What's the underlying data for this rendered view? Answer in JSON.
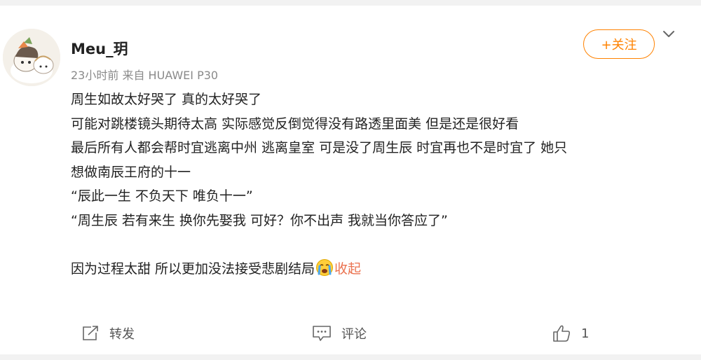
{
  "post": {
    "username": "Meu_玥",
    "meta": "23小时前  来自 HUAWEI P30",
    "follow_label": "+关注",
    "lines": [
      "周生如故太好哭了 真的太好哭了",
      "可能对跳楼镜头期待太高 实际感觉反倒觉得没有路透里面美 但是还是很好看",
      "最后所有人都会帮时宜逃离中州 逃离皇室 可是没了周生辰 时宜再也不是时宜了 她只",
      "想做南辰王府的十一",
      "“辰此一生 不负天下 唯负十一”",
      "“周生辰 若有来生 换你先娶我 可好？你不出声 我就当你答应了”"
    ],
    "last_line": "因为过程太甜 所以更加没法接受悲剧结局",
    "emoji": "crying-face-emoji",
    "collapse_label": "收起"
  },
  "actions": {
    "repost_label": "转发",
    "comment_label": "评论",
    "like_count": "1"
  },
  "colors": {
    "accent": "#ff8200",
    "link": "#eb7350",
    "text": "#222222",
    "meta": "#8a8a8a"
  }
}
